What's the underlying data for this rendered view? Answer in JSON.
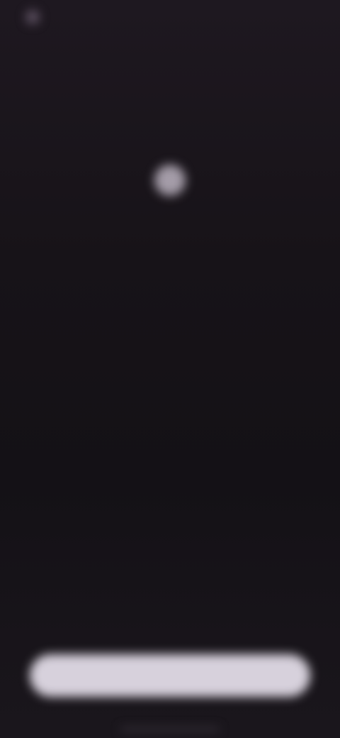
{
  "status_bar": {
    "left_label": "",
    "right_label": ""
  },
  "header": {
    "title": ""
  },
  "hero": {
    "icon": "circle-icon",
    "headline": ""
  },
  "stats": [
    {
      "top": "",
      "value": "",
      "sub": ""
    },
    {
      "top": "",
      "value": "",
      "sub": ""
    },
    {
      "top": "",
      "value": "",
      "sub": ""
    }
  ],
  "description": "",
  "footnote": "",
  "primary_button": {
    "label": ""
  },
  "colors": {
    "background": "#1b171d",
    "button": "#d7d1dc",
    "text_primary": "#e6e1ea",
    "text_muted": "#726a77"
  }
}
